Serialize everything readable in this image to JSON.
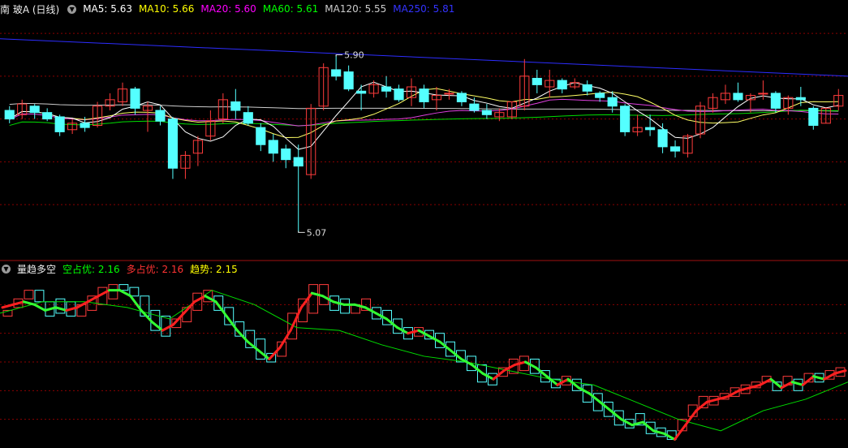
{
  "header": {
    "title": "南 玻A (日线)",
    "ma_items": [
      {
        "label": "MA5: 5.63",
        "color": "#ffffff"
      },
      {
        "label": "MA10: 5.66",
        "color": "#ffff00"
      },
      {
        "label": "MA20: 5.60",
        "color": "#ff00ff"
      },
      {
        "label": "MA60: 5.61",
        "color": "#00ff00"
      },
      {
        "label": "MA120: 5.55",
        "color": "#cccccc"
      },
      {
        "label": "MA250: 5.81",
        "color": "#3333ff"
      }
    ]
  },
  "indicator_header": {
    "title": "量趋多空",
    "items": [
      {
        "label": "空占优: 2.16",
        "color": "#00ff00"
      },
      {
        "label": "多占优: 2.16",
        "color": "#ff3333"
      },
      {
        "label": "趋势: 2.15",
        "color": "#ffff00"
      }
    ]
  },
  "colors": {
    "up": "#ff3c3c",
    "down": "#54ffff",
    "grid": "#8b0000",
    "ma250": "#2d2dff",
    "ma120": "#cccccc",
    "ma60": "#00dd00",
    "ma20": "#e040e0",
    "ma10": "#ffff66",
    "ma5": "#ffffff"
  },
  "chart_data": [
    {
      "type": "candlestick",
      "title": "南 玻A (日线)",
      "ylim": [
        4.95,
        6.08
      ],
      "annotations": [
        {
          "label": "5.90",
          "value": 5.9,
          "index": 26
        },
        {
          "label": "5.07",
          "value": 5.07,
          "index": 23
        }
      ],
      "candles": [
        [
          5.64,
          5.66,
          5.58,
          5.6
        ],
        [
          5.62,
          5.69,
          5.6,
          5.67
        ],
        [
          5.66,
          5.67,
          5.6,
          5.63
        ],
        [
          5.63,
          5.65,
          5.59,
          5.6
        ],
        [
          5.61,
          5.62,
          5.52,
          5.54
        ],
        [
          5.55,
          5.6,
          5.53,
          5.58
        ],
        [
          5.58,
          5.61,
          5.54,
          5.56
        ],
        [
          5.57,
          5.68,
          5.56,
          5.66
        ],
        [
          5.66,
          5.72,
          5.64,
          5.69
        ],
        [
          5.68,
          5.77,
          5.66,
          5.74
        ],
        [
          5.74,
          5.75,
          5.62,
          5.65
        ],
        [
          5.64,
          5.68,
          5.54,
          5.66
        ],
        [
          5.64,
          5.66,
          5.57,
          5.59
        ],
        [
          5.6,
          5.61,
          5.32,
          5.37
        ],
        [
          5.37,
          5.45,
          5.32,
          5.43
        ],
        [
          5.44,
          5.52,
          5.38,
          5.5
        ],
        [
          5.52,
          5.64,
          5.5,
          5.59
        ],
        [
          5.6,
          5.72,
          5.58,
          5.69
        ],
        [
          5.68,
          5.74,
          5.6,
          5.64
        ],
        [
          5.63,
          5.66,
          5.57,
          5.58
        ],
        [
          5.56,
          5.58,
          5.45,
          5.48
        ],
        [
          5.5,
          5.53,
          5.4,
          5.44
        ],
        [
          5.46,
          5.48,
          5.37,
          5.41
        ],
        [
          5.42,
          5.48,
          5.07,
          5.38
        ],
        [
          5.34,
          5.67,
          5.32,
          5.65
        ],
        [
          5.66,
          5.86,
          5.64,
          5.84
        ],
        [
          5.83,
          5.9,
          5.78,
          5.8
        ],
        [
          5.82,
          5.85,
          5.73,
          5.74
        ],
        [
          5.73,
          5.76,
          5.64,
          5.72
        ],
        [
          5.72,
          5.78,
          5.7,
          5.76
        ],
        [
          5.75,
          5.8,
          5.7,
          5.73
        ],
        [
          5.74,
          5.76,
          5.68,
          5.69
        ],
        [
          5.7,
          5.79,
          5.66,
          5.75
        ],
        [
          5.74,
          5.76,
          5.65,
          5.68
        ],
        [
          5.69,
          5.75,
          5.64,
          5.71
        ],
        [
          5.72,
          5.74,
          5.69,
          5.72
        ],
        [
          5.72,
          5.73,
          5.66,
          5.68
        ],
        [
          5.67,
          5.7,
          5.63,
          5.64
        ],
        [
          5.64,
          5.67,
          5.6,
          5.62
        ],
        [
          5.61,
          5.65,
          5.59,
          5.63
        ],
        [
          5.61,
          5.68,
          5.6,
          5.68
        ],
        [
          5.66,
          5.88,
          5.64,
          5.8
        ],
        [
          5.79,
          5.83,
          5.72,
          5.76
        ],
        [
          5.75,
          5.83,
          5.7,
          5.78
        ],
        [
          5.78,
          5.79,
          5.72,
          5.74
        ],
        [
          5.75,
          5.79,
          5.74,
          5.77
        ],
        [
          5.76,
          5.78,
          5.71,
          5.73
        ],
        [
          5.72,
          5.73,
          5.68,
          5.7
        ],
        [
          5.7,
          5.73,
          5.63,
          5.66
        ],
        [
          5.66,
          5.67,
          5.52,
          5.54
        ],
        [
          5.54,
          5.62,
          5.52,
          5.56
        ],
        [
          5.56,
          5.62,
          5.52,
          5.55
        ],
        [
          5.55,
          5.58,
          5.44,
          5.47
        ],
        [
          5.47,
          5.5,
          5.42,
          5.45
        ],
        [
          5.44,
          5.53,
          5.42,
          5.52
        ],
        [
          5.53,
          5.68,
          5.51,
          5.66
        ],
        [
          5.65,
          5.72,
          5.63,
          5.7
        ],
        [
          5.69,
          5.76,
          5.67,
          5.72
        ],
        [
          5.72,
          5.77,
          5.68,
          5.69
        ],
        [
          5.69,
          5.72,
          5.63,
          5.71
        ],
        [
          5.72,
          5.78,
          5.69,
          5.72
        ],
        [
          5.72,
          5.73,
          5.63,
          5.65
        ],
        [
          5.65,
          5.71,
          5.62,
          5.7
        ],
        [
          5.7,
          5.75,
          5.66,
          5.69
        ],
        [
          5.65,
          5.66,
          5.55,
          5.57
        ],
        [
          5.58,
          5.65,
          5.58,
          5.65
        ],
        [
          5.66,
          5.74,
          5.64,
          5.71
        ]
      ],
      "ma": {
        "ma250": [
          5.975,
          5.8
        ],
        "ma120": [
          5.68,
          5.63
        ],
        "ma60": [
          5.545,
          5.61
        ],
        "ma20": [
          5.59,
          5.6
        ],
        "ma10": [
          5.63,
          5.66
        ],
        "ma5": [
          5.63,
          5.63
        ]
      }
    },
    {
      "type": "indicator",
      "title": "量趋多空",
      "ylim": [
        1.9,
        2.5
      ],
      "boxes": [
        [
          2.36,
          2.38,
          1
        ],
        [
          2.39,
          2.42,
          1
        ],
        [
          2.42,
          2.45,
          1
        ],
        [
          2.41,
          2.45,
          0
        ],
        [
          2.36,
          2.41,
          0
        ],
        [
          2.37,
          2.42,
          0
        ],
        [
          2.36,
          2.41,
          0
        ],
        [
          2.36,
          2.4,
          1
        ],
        [
          2.38,
          2.43,
          1
        ],
        [
          2.4,
          2.46,
          1
        ],
        [
          2.42,
          2.47,
          1
        ],
        [
          2.45,
          2.47,
          0
        ],
        [
          2.43,
          2.46,
          0
        ],
        [
          2.36,
          2.43,
          0
        ],
        [
          2.31,
          2.38,
          0
        ],
        [
          2.29,
          2.36,
          0
        ],
        [
          2.32,
          2.35,
          1
        ],
        [
          2.34,
          2.39,
          1
        ],
        [
          2.38,
          2.44,
          1
        ],
        [
          2.41,
          2.45,
          1
        ],
        [
          2.38,
          2.43,
          0
        ],
        [
          2.33,
          2.39,
          0
        ],
        [
          2.29,
          2.34,
          0
        ],
        [
          2.25,
          2.31,
          0
        ],
        [
          2.21,
          2.28,
          0
        ],
        [
          2.2,
          2.23,
          0
        ],
        [
          2.22,
          2.27,
          1
        ],
        [
          2.28,
          2.37,
          1
        ],
        [
          2.34,
          2.42,
          1
        ],
        [
          2.37,
          2.47,
          1
        ],
        [
          2.4,
          2.47,
          1
        ],
        [
          2.38,
          2.43,
          0
        ],
        [
          2.37,
          2.42,
          0
        ],
        [
          2.37,
          2.4,
          1
        ],
        [
          2.38,
          2.42,
          1
        ],
        [
          2.35,
          2.39,
          0
        ],
        [
          2.33,
          2.38,
          0
        ],
        [
          2.3,
          2.35,
          0
        ],
        [
          2.28,
          2.32,
          0
        ],
        [
          2.29,
          2.32,
          1
        ],
        [
          2.28,
          2.31,
          0
        ],
        [
          2.25,
          2.3,
          0
        ],
        [
          2.22,
          2.27,
          0
        ],
        [
          2.2,
          2.24,
          0
        ],
        [
          2.17,
          2.22,
          0
        ],
        [
          2.13,
          2.19,
          0
        ],
        [
          2.12,
          2.16,
          0
        ],
        [
          2.15,
          2.18,
          1
        ],
        [
          2.16,
          2.21,
          1
        ],
        [
          2.17,
          2.22,
          1
        ],
        [
          2.16,
          2.21,
          0
        ],
        [
          2.13,
          2.17,
          0
        ],
        [
          2.11,
          2.14,
          0
        ],
        [
          2.12,
          2.15,
          1
        ],
        [
          2.1,
          2.14,
          0
        ],
        [
          2.06,
          2.12,
          0
        ],
        [
          2.03,
          2.09,
          0
        ],
        [
          2.01,
          2.06,
          0
        ],
        [
          1.98,
          2.03,
          0
        ],
        [
          1.97,
          2.0,
          0
        ],
        [
          1.98,
          2.02,
          0
        ],
        [
          1.95,
          1.99,
          0
        ],
        [
          1.94,
          1.97,
          0
        ],
        [
          1.93,
          1.96,
          0
        ],
        [
          1.96,
          2.0,
          1
        ],
        [
          2.01,
          2.05,
          1
        ],
        [
          2.04,
          2.08,
          1
        ],
        [
          2.05,
          2.08,
          1
        ],
        [
          2.07,
          2.09,
          1
        ],
        [
          2.08,
          2.11,
          1
        ],
        [
          2.09,
          2.12,
          1
        ],
        [
          2.11,
          2.13,
          1
        ],
        [
          2.13,
          2.15,
          1
        ],
        [
          2.1,
          2.13,
          0
        ],
        [
          2.12,
          2.15,
          1
        ],
        [
          2.1,
          2.14,
          0
        ],
        [
          2.13,
          2.16,
          1
        ],
        [
          2.13,
          2.16,
          0
        ],
        [
          2.14,
          2.17,
          1
        ],
        [
          2.15,
          2.18,
          1
        ]
      ],
      "trend_line": [
        2.39,
        2.4,
        2.41,
        2.4,
        2.38,
        2.39,
        2.38,
        2.39,
        2.41,
        2.43,
        2.45,
        2.45,
        2.43,
        2.38,
        2.34,
        2.31,
        2.33,
        2.37,
        2.41,
        2.43,
        2.41,
        2.36,
        2.31,
        2.27,
        2.24,
        2.21,
        2.25,
        2.31,
        2.39,
        2.44,
        2.43,
        2.41,
        2.4,
        2.4,
        2.39,
        2.37,
        2.35,
        2.32,
        2.3,
        2.31,
        2.29,
        2.27,
        2.24,
        2.21,
        2.19,
        2.16,
        2.14,
        2.17,
        2.19,
        2.2,
        2.18,
        2.15,
        2.12,
        2.14,
        2.11,
        2.09,
        2.06,
        2.03,
        2.0,
        1.98,
        1.99,
        1.96,
        1.95,
        1.93,
        1.98,
        2.03,
        2.06,
        2.07,
        2.08,
        2.1,
        2.11,
        2.12,
        2.14,
        2.11,
        2.13,
        2.12,
        2.15,
        2.14,
        2.16,
        2.17
      ],
      "trend_dir": [
        1,
        1,
        1,
        0,
        0,
        0,
        0,
        1,
        1,
        1,
        1,
        0,
        0,
        0,
        0,
        0,
        1,
        1,
        1,
        1,
        0,
        0,
        0,
        0,
        0,
        0,
        1,
        1,
        1,
        1,
        0,
        0,
        0,
        0,
        0,
        0,
        0,
        0,
        0,
        1,
        0,
        0,
        0,
        0,
        0,
        0,
        0,
        1,
        1,
        1,
        0,
        0,
        0,
        1,
        0,
        0,
        0,
        0,
        0,
        0,
        0,
        0,
        0,
        0,
        1,
        1,
        1,
        1,
        1,
        1,
        1,
        1,
        1,
        0,
        1,
        0,
        1,
        0,
        1,
        1
      ],
      "slow_line": [
        2.37,
        2.41,
        2.41,
        2.39,
        2.35,
        2.45,
        2.4,
        2.32,
        2.31,
        2.26,
        2.22,
        2.2,
        2.17,
        2.14,
        2.12,
        2.06,
        2.0,
        1.96,
        2.03,
        2.07,
        2.13
      ],
      "value_labels": [
        "2.16",
        "2.16",
        "2.15"
      ]
    }
  ]
}
